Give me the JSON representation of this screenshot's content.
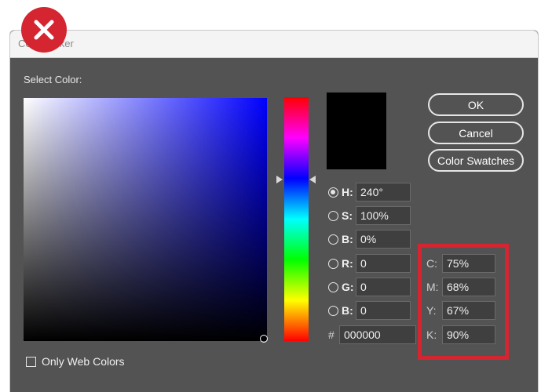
{
  "window": {
    "title": "Color Picker"
  },
  "select_color_label": "Select Color:",
  "buttons": {
    "ok": "OK",
    "cancel": "Cancel",
    "color_swatches": "Color Swatches"
  },
  "hsb": {
    "h": {
      "label": "H:",
      "value": "240°",
      "selected": true
    },
    "s": {
      "label": "S:",
      "value": "100%"
    },
    "b": {
      "label": "B:",
      "value": "0%"
    }
  },
  "rgb": {
    "r": {
      "label": "R:",
      "value": "0"
    },
    "g": {
      "label": "G:",
      "value": "0"
    },
    "b": {
      "label": "B:",
      "value": "0"
    }
  },
  "hex": {
    "label": "#",
    "value": "000000"
  },
  "cmyk": {
    "c": {
      "label": "C:",
      "value": "75%"
    },
    "m": {
      "label": "M:",
      "value": "68%"
    },
    "y": {
      "label": "Y:",
      "value": "67%"
    },
    "k": {
      "label": "K:",
      "value": "90%"
    }
  },
  "only_web_colors": {
    "label": "Only Web Colors",
    "checked": false
  },
  "colors": {
    "dialog_bg": "#535353",
    "current_color": "#000000",
    "highlight": "#d42530",
    "badge": "#d42530"
  },
  "icons": {
    "badge": "close-x-icon"
  }
}
